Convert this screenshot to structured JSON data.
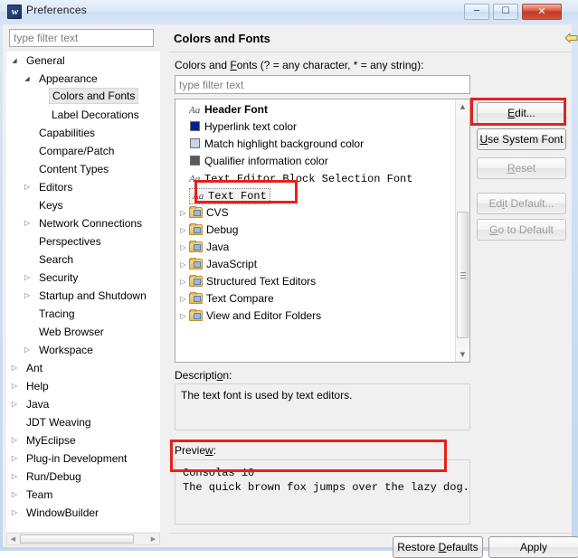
{
  "window": {
    "title": "Preferences",
    "icon": "eclipse-icon",
    "controls": {
      "minimize": "—",
      "maximize": "❐",
      "close": "✕"
    }
  },
  "sidebar": {
    "filter_placeholder": "type filter text",
    "filter_value": "",
    "tree": [
      {
        "label": "General",
        "indent": 0,
        "twisty": "expanded",
        "selected": false
      },
      {
        "label": "Appearance",
        "indent": 1,
        "twisty": "expanded",
        "selected": false
      },
      {
        "label": "Colors and Fonts",
        "indent": 2,
        "twisty": "none",
        "selected": true
      },
      {
        "label": "Label Decorations",
        "indent": 2,
        "twisty": "none",
        "selected": false
      },
      {
        "label": "Capabilities",
        "indent": 1,
        "twisty": "none",
        "selected": false
      },
      {
        "label": "Compare/Patch",
        "indent": 1,
        "twisty": "none",
        "selected": false
      },
      {
        "label": "Content Types",
        "indent": 1,
        "twisty": "none",
        "selected": false
      },
      {
        "label": "Editors",
        "indent": 1,
        "twisty": "collapsed",
        "selected": false
      },
      {
        "label": "Keys",
        "indent": 1,
        "twisty": "none",
        "selected": false
      },
      {
        "label": "Network Connections",
        "indent": 1,
        "twisty": "collapsed",
        "selected": false
      },
      {
        "label": "Perspectives",
        "indent": 1,
        "twisty": "none",
        "selected": false
      },
      {
        "label": "Search",
        "indent": 1,
        "twisty": "none",
        "selected": false
      },
      {
        "label": "Security",
        "indent": 1,
        "twisty": "collapsed",
        "selected": false
      },
      {
        "label": "Startup and Shutdown",
        "indent": 1,
        "twisty": "collapsed",
        "selected": false
      },
      {
        "label": "Tracing",
        "indent": 1,
        "twisty": "none",
        "selected": false
      },
      {
        "label": "Web Browser",
        "indent": 1,
        "twisty": "none",
        "selected": false
      },
      {
        "label": "Workspace",
        "indent": 1,
        "twisty": "collapsed",
        "selected": false
      },
      {
        "label": "Ant",
        "indent": 0,
        "twisty": "collapsed",
        "selected": false
      },
      {
        "label": "Help",
        "indent": 0,
        "twisty": "collapsed",
        "selected": false
      },
      {
        "label": "Java",
        "indent": 0,
        "twisty": "collapsed",
        "selected": false
      },
      {
        "label": "JDT Weaving",
        "indent": 0,
        "twisty": "none",
        "selected": false
      },
      {
        "label": "MyEclipse",
        "indent": 0,
        "twisty": "collapsed",
        "selected": false
      },
      {
        "label": "Plug-in Development",
        "indent": 0,
        "twisty": "collapsed",
        "selected": false
      },
      {
        "label": "Run/Debug",
        "indent": 0,
        "twisty": "collapsed",
        "selected": false
      },
      {
        "label": "Team",
        "indent": 0,
        "twisty": "collapsed",
        "selected": false
      },
      {
        "label": "WindowBuilder",
        "indent": 0,
        "twisty": "collapsed",
        "selected": false
      }
    ]
  },
  "page": {
    "title": "Colors and Fonts",
    "filter_label_pre": "Colors and ",
    "filter_label_accel": "F",
    "filter_label_post": "onts (? = any character, * = any string):",
    "filter_placeholder": "type filter text",
    "filter_value": "",
    "nav": {
      "back": "back-arrow",
      "back_menu": "chevron-down",
      "forward": "forward-arrow",
      "forward_menu": "chevron-down",
      "view_menu": "chevron-down"
    },
    "list": [
      {
        "label": "Header Font",
        "icon": "font-aa",
        "style": "bold",
        "twisty": "none",
        "selected": false
      },
      {
        "label": "Hyperlink text color",
        "icon": "color-swatch",
        "color": "#0a1f8f",
        "style": "normal",
        "twisty": "none",
        "selected": false
      },
      {
        "label": "Match highlight background color",
        "icon": "color-swatch",
        "color": "#c9d4e8",
        "style": "normal",
        "twisty": "none",
        "selected": false
      },
      {
        "label": "Qualifier information color",
        "icon": "color-swatch",
        "color": "#5a5a5a",
        "style": "normal",
        "twisty": "none",
        "selected": false
      },
      {
        "label": "Text Editor Block Selection Font",
        "icon": "font-aa",
        "style": "mono",
        "twisty": "none",
        "selected": false
      },
      {
        "label": "Text Font",
        "icon": "font-aa",
        "style": "mono",
        "twisty": "none",
        "selected": true
      },
      {
        "label": "CVS",
        "icon": "folder",
        "style": "normal",
        "twisty": "collapsed",
        "selected": false
      },
      {
        "label": "Debug",
        "icon": "folder",
        "style": "normal",
        "twisty": "collapsed",
        "selected": false
      },
      {
        "label": "Java",
        "icon": "folder",
        "style": "normal",
        "twisty": "collapsed",
        "selected": false
      },
      {
        "label": "JavaScript",
        "icon": "folder",
        "style": "normal",
        "twisty": "collapsed",
        "selected": false
      },
      {
        "label": "Structured Text Editors",
        "icon": "folder",
        "style": "normal",
        "twisty": "collapsed",
        "selected": false
      },
      {
        "label": "Text Compare",
        "icon": "folder",
        "style": "normal",
        "twisty": "collapsed",
        "selected": false
      },
      {
        "label": "View and Editor Folders",
        "icon": "folder",
        "style": "normal",
        "twisty": "collapsed",
        "selected": false
      }
    ],
    "buttons": {
      "edit": {
        "label": "Edit...",
        "accel": "E",
        "enabled": true
      },
      "use_system_font": {
        "label": "Use System Font",
        "accel": "U",
        "enabled": true
      },
      "reset": {
        "label": "Reset",
        "accel": "R",
        "enabled": false
      },
      "edit_default": {
        "label": "Edit Default...",
        "accel": "i",
        "enabled": false
      },
      "go_to_default": {
        "label": "Go to Default",
        "accel": "G",
        "enabled": false
      }
    },
    "description": {
      "label_pre": "Descripti",
      "label_accel": "o",
      "label_post": "n:",
      "text": "The text font is used by text editors."
    },
    "preview": {
      "label_pre": "Previe",
      "label_accel": "w",
      "label_post": ":",
      "line1": "Consolas 10",
      "line2": "The quick brown fox jumps over the lazy dog."
    }
  },
  "footer": {
    "restore_defaults": {
      "label_pre": "Restore ",
      "label_accel": "D",
      "label_post": "efaults"
    },
    "apply": {
      "label": "Apply"
    }
  },
  "annotations": {
    "accent_color": "#e8201b",
    "boxes": [
      "edit-button",
      "text-font-row",
      "preview-box"
    ]
  }
}
